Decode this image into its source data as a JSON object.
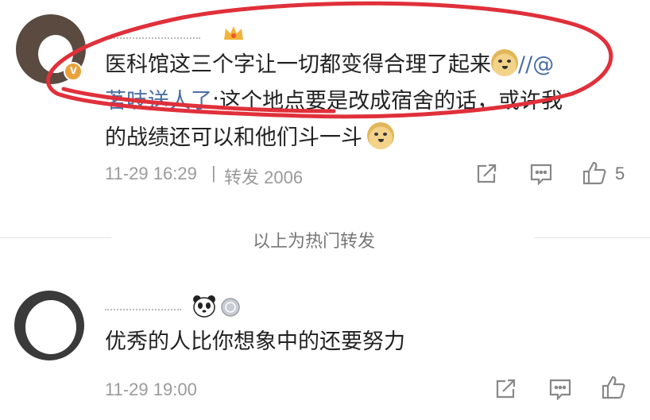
{
  "comment1": {
    "text_line1": "医科馆这三个字让一切都变得合理了起来",
    "slash": "//@",
    "mention": "茗吱送人了",
    "text_line2_rest": ":这个地点要是改成宿舍的话，或许我",
    "text_line3": "的战绩还可以和他们斗一斗",
    "timestamp": "11-29 16:29",
    "separator": "|",
    "repost_label": "转发 2006",
    "like_count": "5"
  },
  "hot_repost_label": "以上为热门转发",
  "comment2": {
    "text": "优秀的人比你想象中的还要努力",
    "timestamp": "11-29 19:00"
  },
  "icons": [
    "share-icon",
    "comment-icon",
    "like-icon",
    "crown-icon",
    "panda-icon",
    "medal-icon",
    "doge-emoji"
  ],
  "colors": {
    "mention": "#4a6fa5",
    "meta": "#9a9a9a",
    "annotation": "#e0303a"
  }
}
